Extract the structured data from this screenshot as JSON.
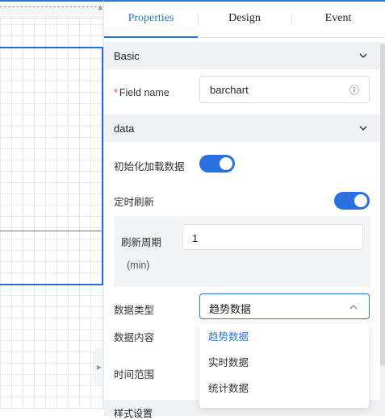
{
  "tabs": [
    "Properties",
    "Design",
    "Event"
  ],
  "sections": {
    "basic": "Basic",
    "data": "data",
    "next_partial": "样式设置"
  },
  "field_name": {
    "label": "Field name",
    "required_mark": "*",
    "value": "barchart",
    "info_icon": "ⓘ"
  },
  "init_load": {
    "label": "初始化加载数据",
    "on": true
  },
  "timed_refresh": {
    "label": "定时刷新",
    "on": true
  },
  "refresh_period": {
    "label": "刷新周期",
    "unit": "(min)",
    "value": "1"
  },
  "data_type": {
    "label": "数据类型",
    "selected": "趋势数据"
  },
  "data_content": {
    "label": "数据内容"
  },
  "time_range": {
    "label": "时间范围"
  },
  "dropdown_options": [
    "趋势数据",
    "实时数据",
    "统计数据"
  ],
  "colors": {
    "accent": "#2a78d6",
    "toggle": "#2b6fe0",
    "required": "#e34d59"
  }
}
